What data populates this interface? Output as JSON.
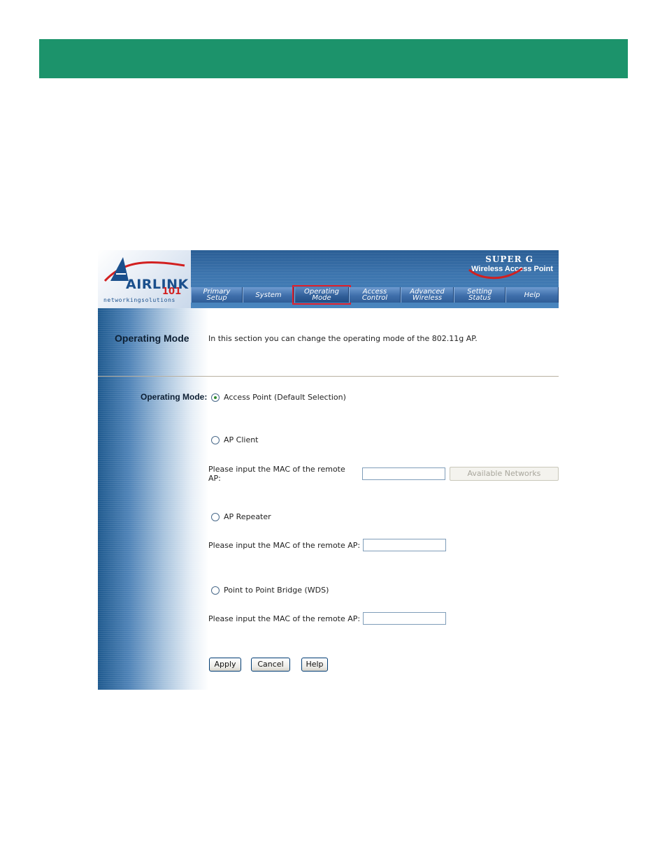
{
  "header": {
    "logo_main": "AIRLINK",
    "logo_number": "101",
    "logo_tagline": "networkingsolutions",
    "brand_line1": "SUPER G",
    "brand_line2": "Wireless Access Point"
  },
  "tabs": [
    {
      "line1": "Primary",
      "line2": "Setup"
    },
    {
      "line1": "System",
      "line2": ""
    },
    {
      "line1": "Operating",
      "line2": "Mode"
    },
    {
      "line1": "Access",
      "line2": "Control"
    },
    {
      "line1": "Advanced",
      "line2": "Wireless"
    },
    {
      "line1": "Setting",
      "line2": "Status"
    },
    {
      "line1": "Help",
      "line2": ""
    }
  ],
  "active_tab": "Operating Mode",
  "section": {
    "title": "Operating Mode",
    "description": "In this section you can change the operating mode of the 802.11g AP."
  },
  "form": {
    "mode_label": "Operating Mode:",
    "options": [
      {
        "label": "Access Point (Default Selection)",
        "checked": true
      },
      {
        "label": "AP Client",
        "checked": false
      },
      {
        "label": "AP Repeater",
        "checked": false
      },
      {
        "label": "Point to Point Bridge (WDS)",
        "checked": false
      }
    ],
    "mac_prompt": "Please input the MAC of the remote AP:",
    "mac_values": [
      "",
      "",
      ""
    ],
    "available_networks_label": "Available Networks"
  },
  "buttons": {
    "apply": "Apply",
    "cancel": "Cancel",
    "help": "Help"
  },
  "colors": {
    "banner": "#1c936b",
    "header_blue": "#3c74ad",
    "active_tab_outline": "#e2202a"
  }
}
